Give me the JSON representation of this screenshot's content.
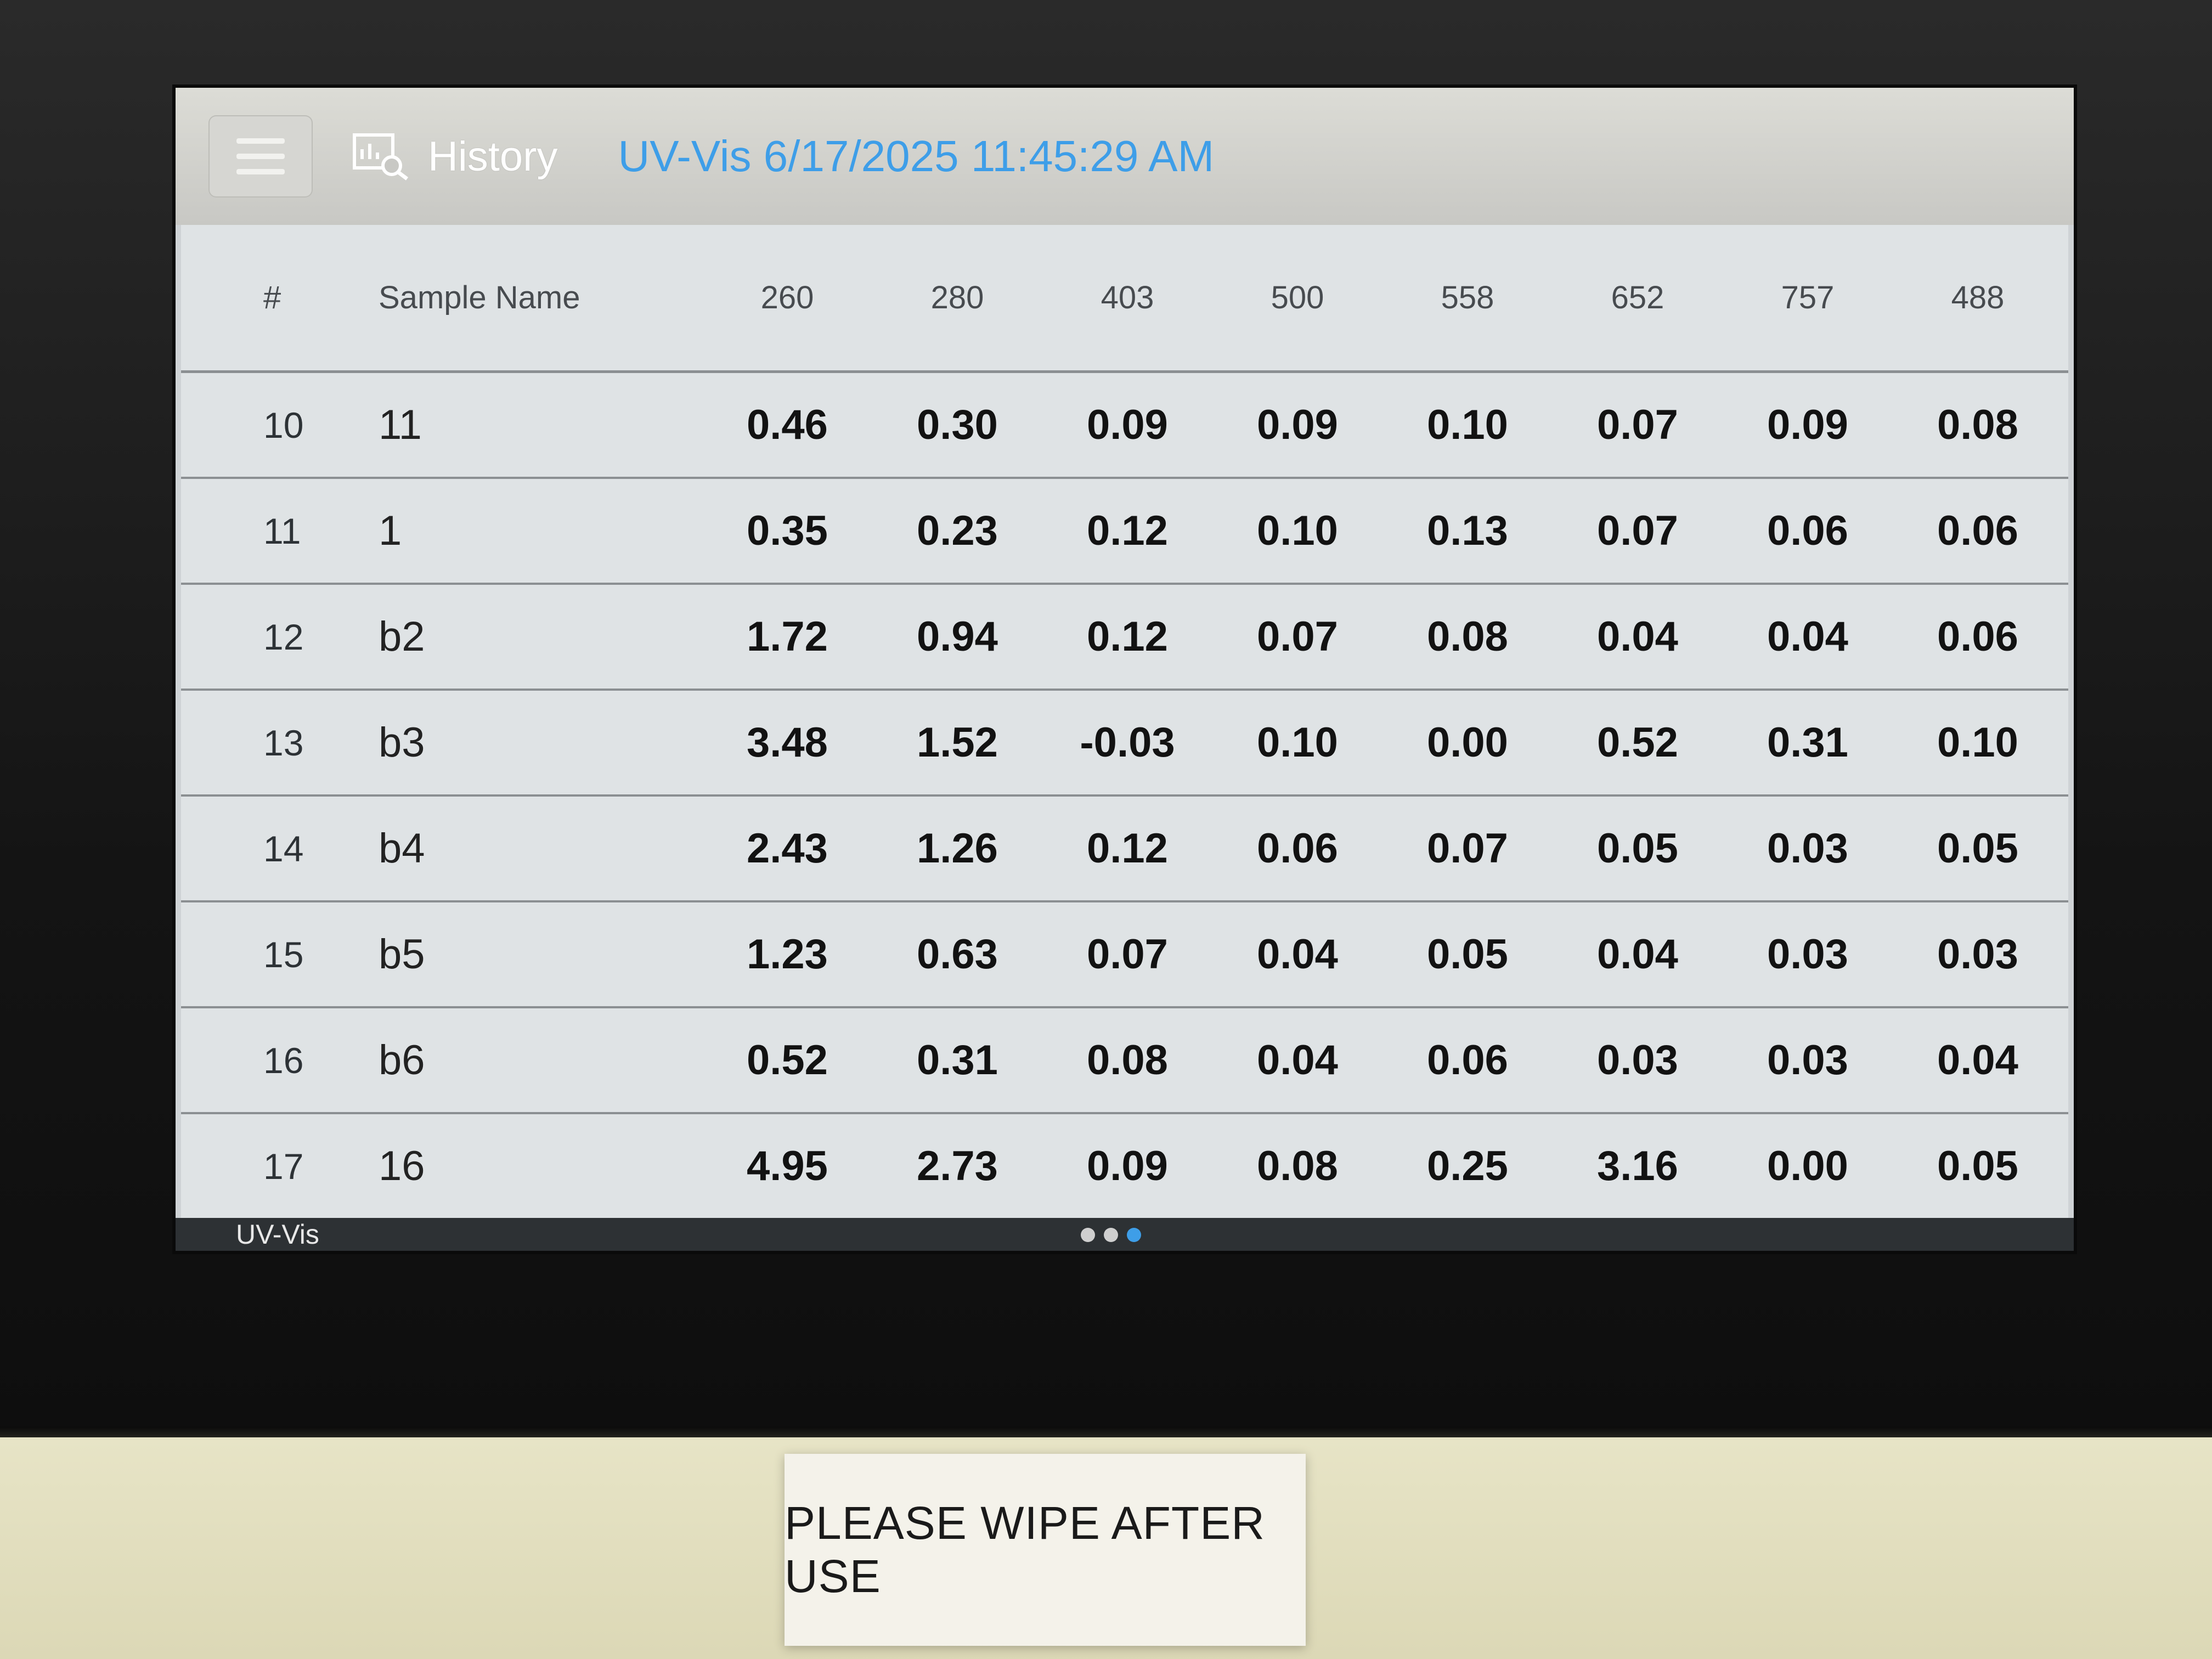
{
  "header": {
    "history_label": "History",
    "session_title": "UV-Vis 6/17/2025 11:45:29 AM",
    "accent_color": "#3e9ee8"
  },
  "table": {
    "columns": [
      "#",
      "Sample Name",
      "260",
      "280",
      "403",
      "500",
      "558",
      "652",
      "757",
      "488"
    ],
    "rows": [
      {
        "index": "10",
        "name": "11",
        "values": [
          "0.46",
          "0.30",
          "0.09",
          "0.09",
          "0.10",
          "0.07",
          "0.09",
          "0.08"
        ]
      },
      {
        "index": "11",
        "name": "1",
        "values": [
          "0.35",
          "0.23",
          "0.12",
          "0.10",
          "0.13",
          "0.07",
          "0.06",
          "0.06"
        ]
      },
      {
        "index": "12",
        "name": "b2",
        "values": [
          "1.72",
          "0.94",
          "0.12",
          "0.07",
          "0.08",
          "0.04",
          "0.04",
          "0.06"
        ]
      },
      {
        "index": "13",
        "name": "b3",
        "values": [
          "3.48",
          "1.52",
          "-0.03",
          "0.10",
          "0.00",
          "0.52",
          "0.31",
          "0.10"
        ]
      },
      {
        "index": "14",
        "name": "b4",
        "values": [
          "2.43",
          "1.26",
          "0.12",
          "0.06",
          "0.07",
          "0.05",
          "0.03",
          "0.05"
        ]
      },
      {
        "index": "15",
        "name": "b5",
        "values": [
          "1.23",
          "0.63",
          "0.07",
          "0.04",
          "0.05",
          "0.04",
          "0.03",
          "0.03"
        ]
      },
      {
        "index": "16",
        "name": "b6",
        "values": [
          "0.52",
          "0.31",
          "0.08",
          "0.04",
          "0.06",
          "0.03",
          "0.03",
          "0.04"
        ]
      },
      {
        "index": "17",
        "name": "16",
        "values": [
          "4.95",
          "2.73",
          "0.09",
          "0.08",
          "0.25",
          "3.16",
          "0.00",
          "0.05"
        ]
      }
    ]
  },
  "status": {
    "label": "UV-Vis",
    "page_count": 3,
    "active_page": 3
  },
  "sticker": {
    "text": "PLEASE WIPE AFTER USE"
  },
  "icons": {
    "menu": "hamburger-menu-icon",
    "history": "history-chart-search-icon"
  }
}
